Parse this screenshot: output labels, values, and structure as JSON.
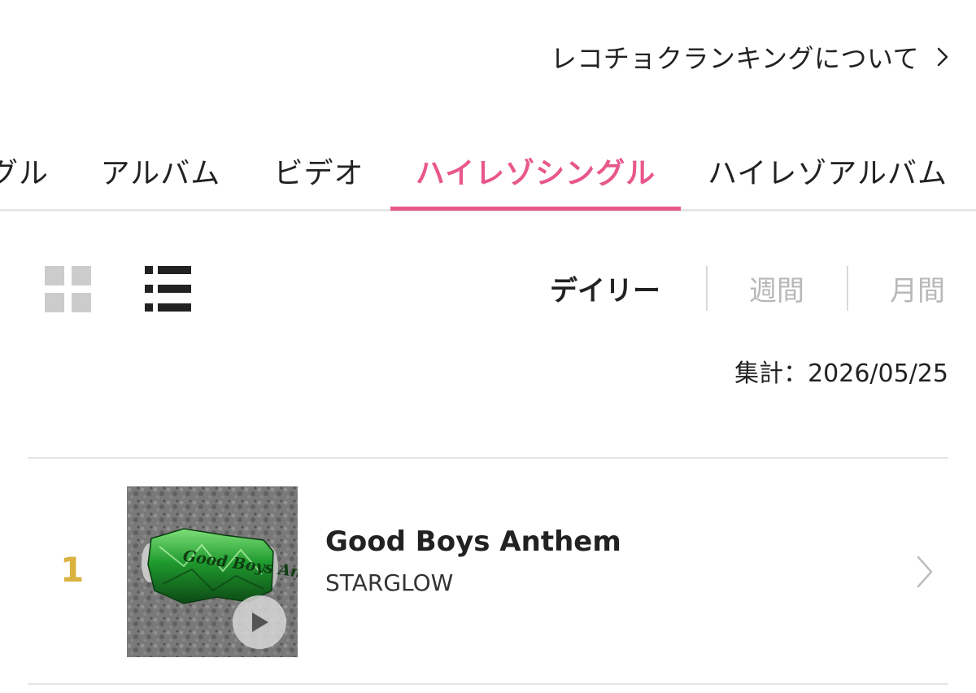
{
  "header": {
    "about_link": "レコチョクランキングについて"
  },
  "tabs": [
    {
      "label": "グル"
    },
    {
      "label": "アルバム"
    },
    {
      "label": "ビデオ"
    },
    {
      "label": "ハイレゾシングル",
      "active": true
    },
    {
      "label": "ハイレゾアルバム"
    }
  ],
  "view_toggle": {
    "options": [
      "grid-view-icon",
      "list-view-icon"
    ],
    "selected": "list-view-icon"
  },
  "periods": [
    {
      "label": "デイリー",
      "active": true
    },
    {
      "label": "週間"
    },
    {
      "label": "月間"
    }
  ],
  "aggregate": {
    "text": "集計：2026/05/25"
  },
  "ranking": [
    {
      "rank": "1",
      "title": "Good Boys Anthem",
      "artist": "STARGLOW",
      "jacket_text": "Good Boys Anthem"
    }
  ],
  "colors": {
    "accent": "#e8578b",
    "rank_gold": "#d9b23f",
    "inactive": "#b8b8b8"
  }
}
